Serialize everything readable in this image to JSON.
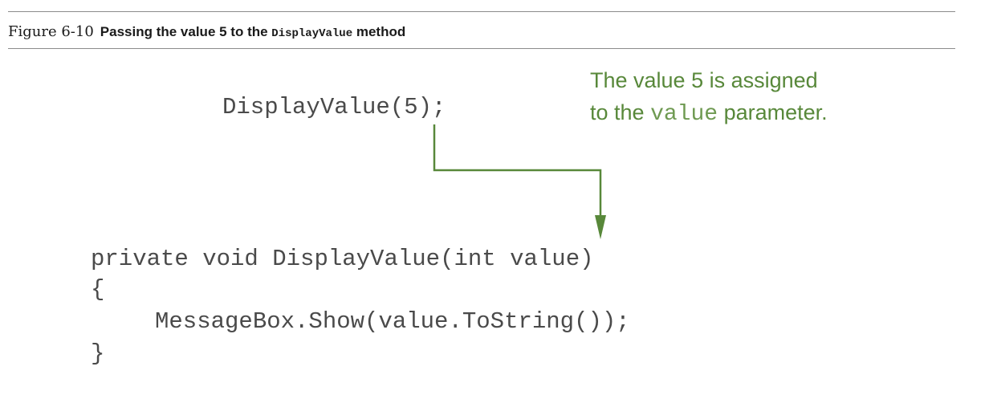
{
  "caption": {
    "number": "Figure 6-10",
    "title_prefix": "Passing the value 5 to the ",
    "title_code": "DisplayValue",
    "title_suffix": " method"
  },
  "call_statement": "DisplayValue(5);",
  "annotation": {
    "line1": "The value 5 is assigned",
    "line2_prefix": "to the ",
    "line2_code": "value",
    "line2_suffix": " parameter."
  },
  "method_code": [
    "private void DisplayValue(int value)",
    "{",
    "MessageBox.Show(value.ToString());",
    "}"
  ],
  "colors": {
    "accent": "#58883a",
    "code_text": "#4a4a4a",
    "rule": "#8c8c8c"
  }
}
